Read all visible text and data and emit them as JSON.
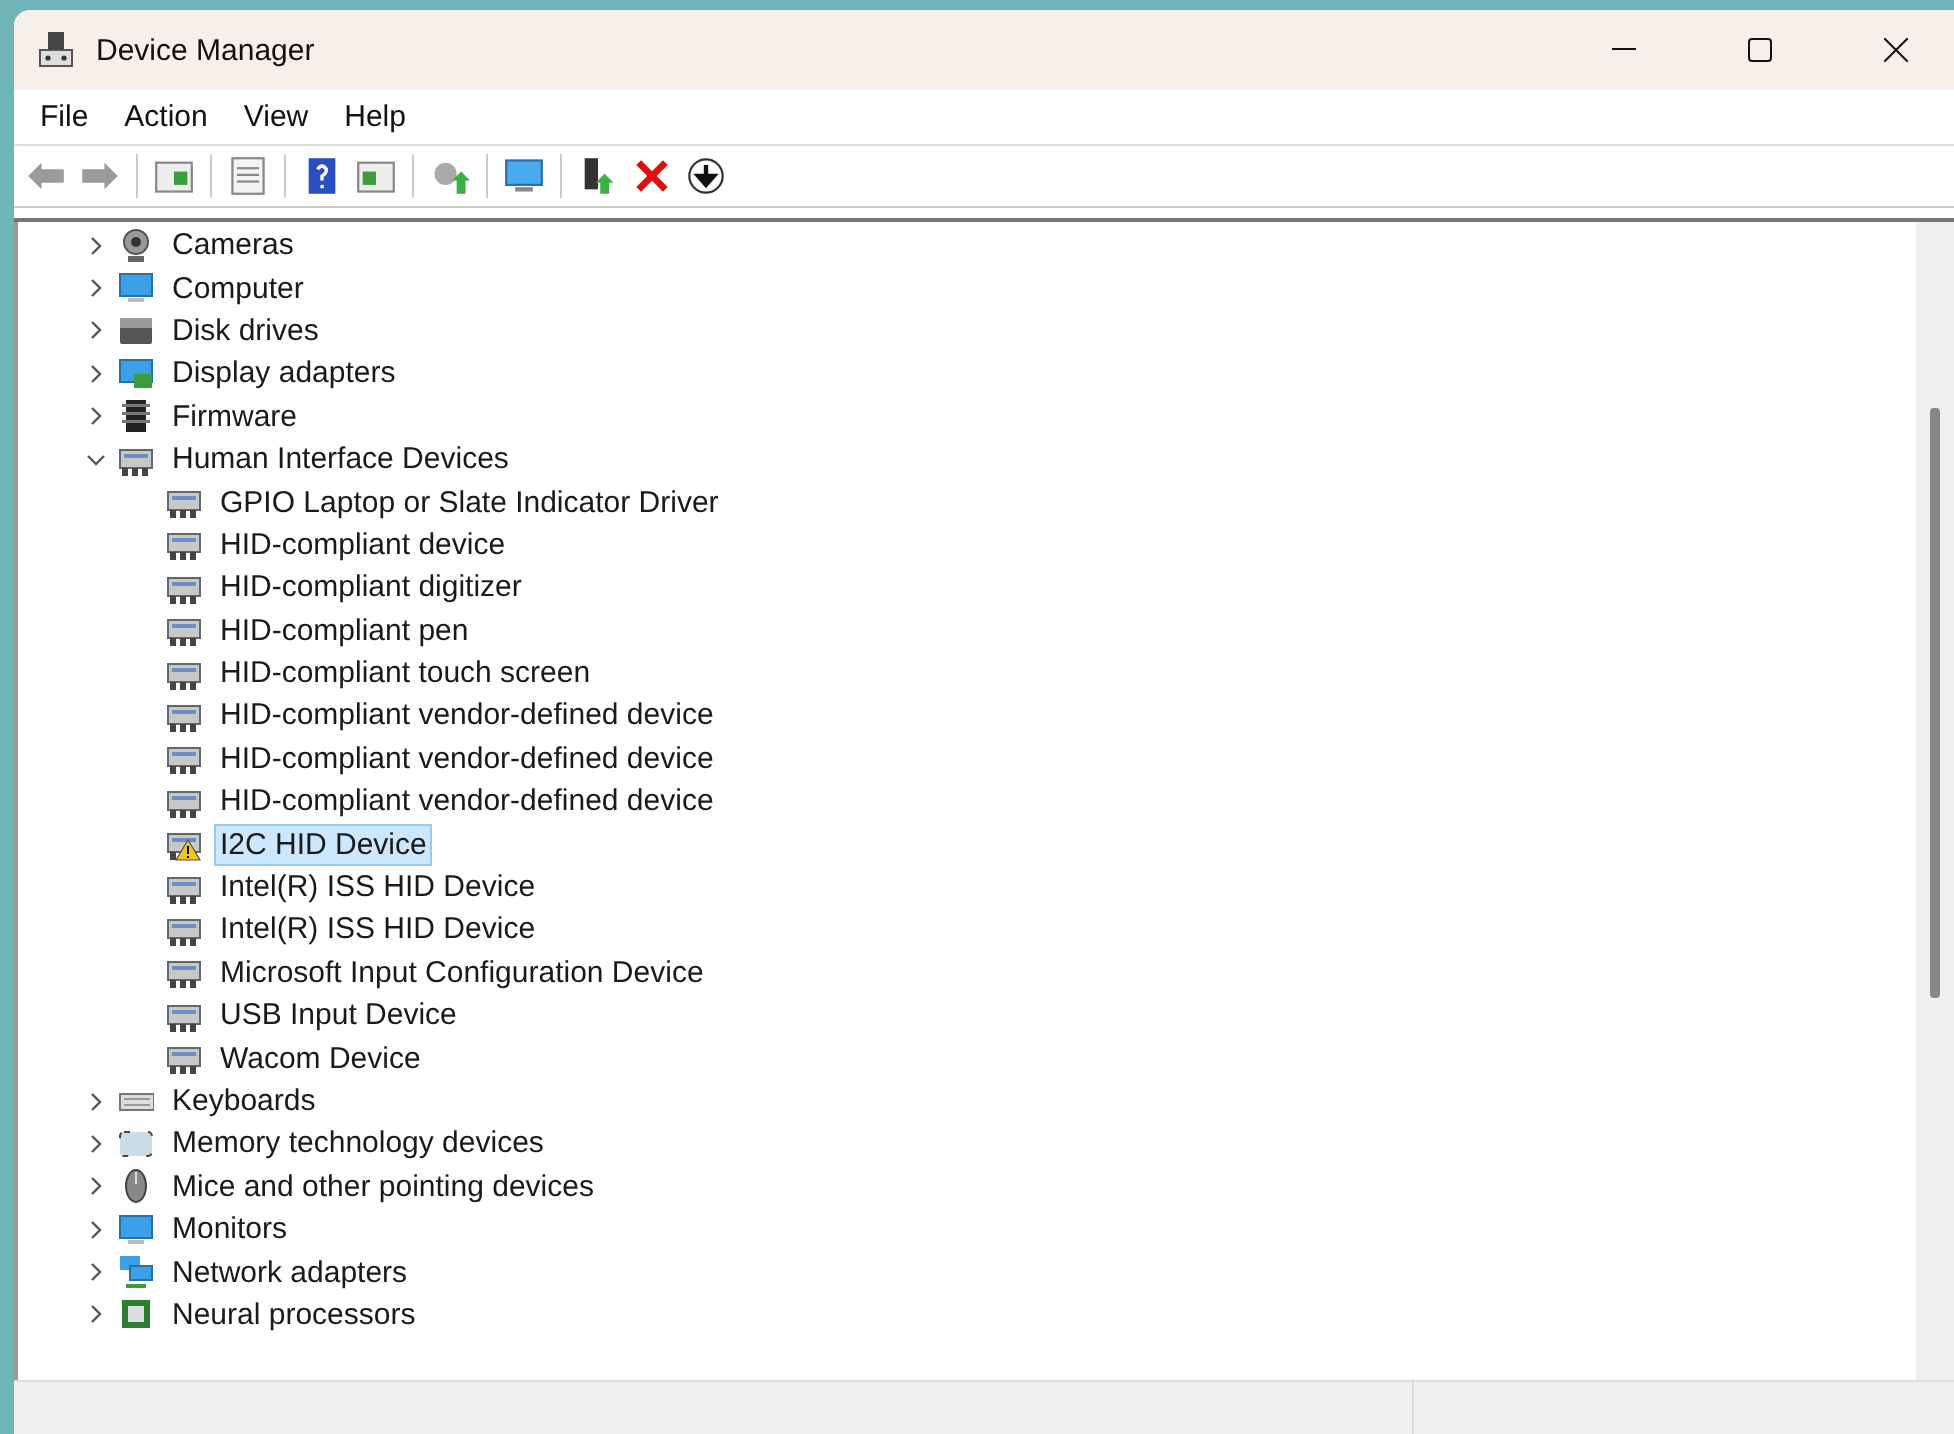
{
  "window": {
    "title": "Device Manager"
  },
  "menu": [
    "File",
    "Action",
    "View",
    "Help"
  ],
  "tree": [
    {
      "label": "Cameras",
      "expanded": false
    },
    {
      "label": "Computer",
      "expanded": false
    },
    {
      "label": "Disk drives",
      "expanded": false
    },
    {
      "label": "Display adapters",
      "expanded": false
    },
    {
      "label": "Firmware",
      "expanded": false
    },
    {
      "label": "Human Interface Devices",
      "expanded": true,
      "children": [
        {
          "label": "GPIO Laptop or Slate Indicator Driver",
          "selected": false,
          "warning": false
        },
        {
          "label": "HID-compliant device",
          "selected": false,
          "warning": false
        },
        {
          "label": "HID-compliant digitizer",
          "selected": false,
          "warning": false
        },
        {
          "label": "HID-compliant pen",
          "selected": false,
          "warning": false
        },
        {
          "label": "HID-compliant touch screen",
          "selected": false,
          "warning": false
        },
        {
          "label": "HID-compliant vendor-defined device",
          "selected": false,
          "warning": false
        },
        {
          "label": "HID-compliant vendor-defined device",
          "selected": false,
          "warning": false
        },
        {
          "label": "HID-compliant vendor-defined device",
          "selected": false,
          "warning": false
        },
        {
          "label": "I2C HID Device",
          "selected": true,
          "warning": true
        },
        {
          "label": "Intel(R) ISS HID Device",
          "selected": false,
          "warning": false
        },
        {
          "label": "Intel(R) ISS HID Device",
          "selected": false,
          "warning": false
        },
        {
          "label": "Microsoft Input Configuration Device",
          "selected": false,
          "warning": false
        },
        {
          "label": "USB Input Device",
          "selected": false,
          "warning": false
        },
        {
          "label": "Wacom Device",
          "selected": false,
          "warning": false
        }
      ]
    },
    {
      "label": "Keyboards",
      "expanded": false
    },
    {
      "label": "Memory technology devices",
      "expanded": false
    },
    {
      "label": "Mice and other pointing devices",
      "expanded": false
    },
    {
      "label": "Monitors",
      "expanded": false
    },
    {
      "label": "Network adapters",
      "expanded": false
    },
    {
      "label": "Neural processors",
      "expanded": false
    }
  ]
}
